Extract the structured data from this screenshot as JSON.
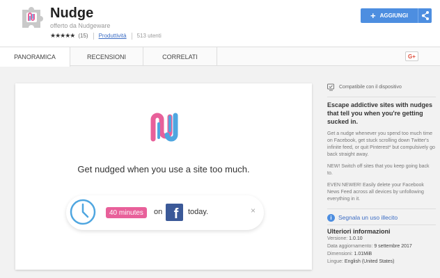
{
  "header": {
    "title": "Nudge",
    "offered_by": "offerto da Nudgeware",
    "stars": "★★★★★",
    "rating_count": "(15)",
    "category": "Produttività",
    "users": "513 utenti",
    "add_label": "AGGIUNGI",
    "add_icon": "+"
  },
  "tabs": [
    {
      "label": "PANORAMICA"
    },
    {
      "label": "RECENSIONI"
    },
    {
      "label": "CORRELATI"
    }
  ],
  "gplus_label": "G+",
  "preview": {
    "headline": "Get nudged when you use a site too much.",
    "minutes": "40 minutes",
    "on": "on",
    "fb_letter": "f",
    "today": "today.",
    "close": "×"
  },
  "sidebar": {
    "compatible": "Compatibile con il dispositivo",
    "desc_title": "Escape addictive sites with nudges that tell you when you're getting sucked in.",
    "paragraphs": [
      "Get a nudge whenever you spend too much time on Facebook, get stuck scrolling down Twitter's infinite feed, or quit Pinterest* but compulsively go back straight away.",
      "NEW! Switch off sites that you keep going back to.",
      "EVEN NEWER! Easily delete your Facebook News Feed across all devices by unfollowing everything in it."
    ],
    "report": "Segnala un uso illecito",
    "info_icon": "i",
    "more_title": "Ulteriori informazioni",
    "rows": [
      {
        "label": "Versione:",
        "value": "1.0.10"
      },
      {
        "label": "Data aggiornamento:",
        "value": "9 settembre 2017"
      },
      {
        "label": "Dimensioni:",
        "value": "1.01MiB"
      },
      {
        "label": "Lingue:",
        "value": "English (United States)"
      }
    ]
  },
  "colors": {
    "accent_blue": "#4d8ee0",
    "nudge_pink": "#e8609a",
    "nudge_blue": "#4fa6e0",
    "facebook": "#3b5998"
  }
}
